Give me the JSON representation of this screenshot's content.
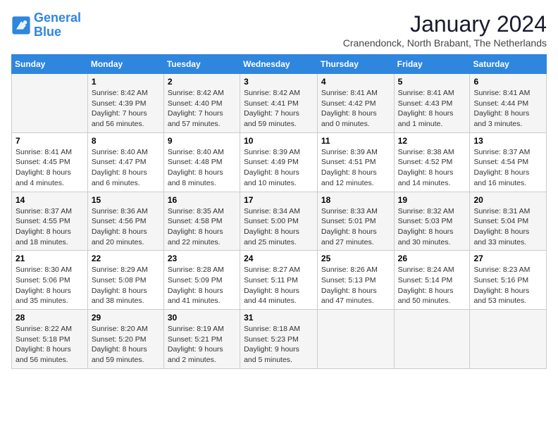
{
  "logo": {
    "line1": "General",
    "line2": "Blue"
  },
  "title": "January 2024",
  "location": "Cranendonck, North Brabant, The Netherlands",
  "weekdays": [
    "Sunday",
    "Monday",
    "Tuesday",
    "Wednesday",
    "Thursday",
    "Friday",
    "Saturday"
  ],
  "weeks": [
    [
      {
        "day": "",
        "info": ""
      },
      {
        "day": "1",
        "info": "Sunrise: 8:42 AM\nSunset: 4:39 PM\nDaylight: 7 hours\nand 56 minutes."
      },
      {
        "day": "2",
        "info": "Sunrise: 8:42 AM\nSunset: 4:40 PM\nDaylight: 7 hours\nand 57 minutes."
      },
      {
        "day": "3",
        "info": "Sunrise: 8:42 AM\nSunset: 4:41 PM\nDaylight: 7 hours\nand 59 minutes."
      },
      {
        "day": "4",
        "info": "Sunrise: 8:41 AM\nSunset: 4:42 PM\nDaylight: 8 hours\nand 0 minutes."
      },
      {
        "day": "5",
        "info": "Sunrise: 8:41 AM\nSunset: 4:43 PM\nDaylight: 8 hours\nand 1 minute."
      },
      {
        "day": "6",
        "info": "Sunrise: 8:41 AM\nSunset: 4:44 PM\nDaylight: 8 hours\nand 3 minutes."
      }
    ],
    [
      {
        "day": "7",
        "info": "Sunrise: 8:41 AM\nSunset: 4:45 PM\nDaylight: 8 hours\nand 4 minutes."
      },
      {
        "day": "8",
        "info": "Sunrise: 8:40 AM\nSunset: 4:47 PM\nDaylight: 8 hours\nand 6 minutes."
      },
      {
        "day": "9",
        "info": "Sunrise: 8:40 AM\nSunset: 4:48 PM\nDaylight: 8 hours\nand 8 minutes."
      },
      {
        "day": "10",
        "info": "Sunrise: 8:39 AM\nSunset: 4:49 PM\nDaylight: 8 hours\nand 10 minutes."
      },
      {
        "day": "11",
        "info": "Sunrise: 8:39 AM\nSunset: 4:51 PM\nDaylight: 8 hours\nand 12 minutes."
      },
      {
        "day": "12",
        "info": "Sunrise: 8:38 AM\nSunset: 4:52 PM\nDaylight: 8 hours\nand 14 minutes."
      },
      {
        "day": "13",
        "info": "Sunrise: 8:37 AM\nSunset: 4:54 PM\nDaylight: 8 hours\nand 16 minutes."
      }
    ],
    [
      {
        "day": "14",
        "info": "Sunrise: 8:37 AM\nSunset: 4:55 PM\nDaylight: 8 hours\nand 18 minutes."
      },
      {
        "day": "15",
        "info": "Sunrise: 8:36 AM\nSunset: 4:56 PM\nDaylight: 8 hours\nand 20 minutes."
      },
      {
        "day": "16",
        "info": "Sunrise: 8:35 AM\nSunset: 4:58 PM\nDaylight: 8 hours\nand 22 minutes."
      },
      {
        "day": "17",
        "info": "Sunrise: 8:34 AM\nSunset: 5:00 PM\nDaylight: 8 hours\nand 25 minutes."
      },
      {
        "day": "18",
        "info": "Sunrise: 8:33 AM\nSunset: 5:01 PM\nDaylight: 8 hours\nand 27 minutes."
      },
      {
        "day": "19",
        "info": "Sunrise: 8:32 AM\nSunset: 5:03 PM\nDaylight: 8 hours\nand 30 minutes."
      },
      {
        "day": "20",
        "info": "Sunrise: 8:31 AM\nSunset: 5:04 PM\nDaylight: 8 hours\nand 33 minutes."
      }
    ],
    [
      {
        "day": "21",
        "info": "Sunrise: 8:30 AM\nSunset: 5:06 PM\nDaylight: 8 hours\nand 35 minutes."
      },
      {
        "day": "22",
        "info": "Sunrise: 8:29 AM\nSunset: 5:08 PM\nDaylight: 8 hours\nand 38 minutes."
      },
      {
        "day": "23",
        "info": "Sunrise: 8:28 AM\nSunset: 5:09 PM\nDaylight: 8 hours\nand 41 minutes."
      },
      {
        "day": "24",
        "info": "Sunrise: 8:27 AM\nSunset: 5:11 PM\nDaylight: 8 hours\nand 44 minutes."
      },
      {
        "day": "25",
        "info": "Sunrise: 8:26 AM\nSunset: 5:13 PM\nDaylight: 8 hours\nand 47 minutes."
      },
      {
        "day": "26",
        "info": "Sunrise: 8:24 AM\nSunset: 5:14 PM\nDaylight: 8 hours\nand 50 minutes."
      },
      {
        "day": "27",
        "info": "Sunrise: 8:23 AM\nSunset: 5:16 PM\nDaylight: 8 hours\nand 53 minutes."
      }
    ],
    [
      {
        "day": "28",
        "info": "Sunrise: 8:22 AM\nSunset: 5:18 PM\nDaylight: 8 hours\nand 56 minutes."
      },
      {
        "day": "29",
        "info": "Sunrise: 8:20 AM\nSunset: 5:20 PM\nDaylight: 8 hours\nand 59 minutes."
      },
      {
        "day": "30",
        "info": "Sunrise: 8:19 AM\nSunset: 5:21 PM\nDaylight: 9 hours\nand 2 minutes."
      },
      {
        "day": "31",
        "info": "Sunrise: 8:18 AM\nSunset: 5:23 PM\nDaylight: 9 hours\nand 5 minutes."
      },
      {
        "day": "",
        "info": ""
      },
      {
        "day": "",
        "info": ""
      },
      {
        "day": "",
        "info": ""
      }
    ]
  ]
}
